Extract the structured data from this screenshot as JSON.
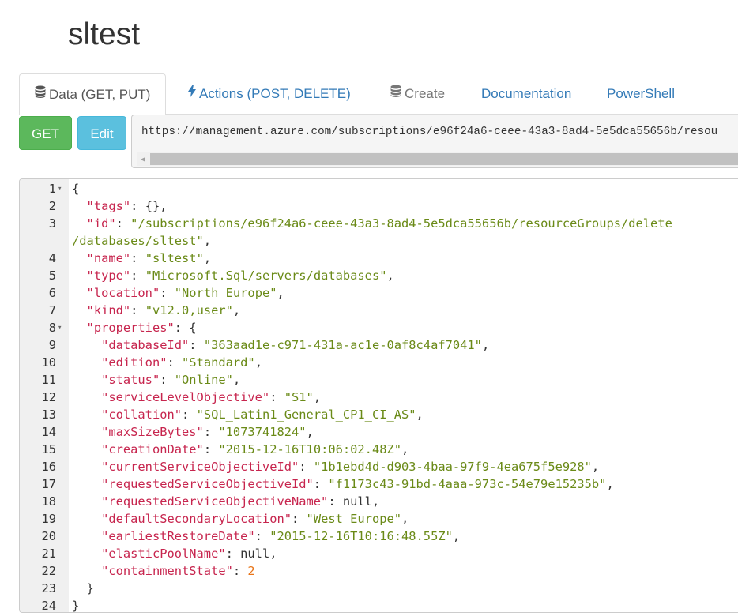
{
  "page": {
    "title": "sltest"
  },
  "tabs": [
    {
      "label": "Data (GET, PUT)",
      "icon": "database-icon",
      "active": true
    },
    {
      "label": "Actions (POST, DELETE)",
      "icon": "bolt-icon",
      "active": false
    },
    {
      "label": "Create",
      "icon": "database-icon",
      "active": false
    },
    {
      "label": "Documentation",
      "active": false
    },
    {
      "label": "PowerShell",
      "active": false
    }
  ],
  "buttons": {
    "get_label": "GET",
    "edit_label": "Edit"
  },
  "url": {
    "value": "https://management.azure.com/subscriptions/e96f24a6-ceee-43a3-8ad4-5e5dca55656b/resou"
  },
  "editor": {
    "lines": [
      {
        "n": "1",
        "fold": true,
        "t": [
          [
            "p",
            "{"
          ]
        ]
      },
      {
        "n": "2",
        "t": [
          [
            "p",
            "  "
          ],
          [
            "k",
            "\"tags\""
          ],
          [
            "p",
            ": {},"
          ]
        ]
      },
      {
        "n": "3",
        "t": [
          [
            "p",
            "  "
          ],
          [
            "k",
            "\"id\""
          ],
          [
            "p",
            ": "
          ],
          [
            "s",
            "\"/subscriptions/e96f24a6-ceee-43a3-8ad4-5e5dca55656b/resourceGroups/delete"
          ]
        ]
      },
      {
        "n": "",
        "t": [
          [
            "s",
            "/databases/sltest\""
          ],
          [
            "p",
            ","
          ]
        ]
      },
      {
        "n": "4",
        "t": [
          [
            "p",
            "  "
          ],
          [
            "k",
            "\"name\""
          ],
          [
            "p",
            ": "
          ],
          [
            "s",
            "\"sltest\""
          ],
          [
            "p",
            ","
          ]
        ]
      },
      {
        "n": "5",
        "t": [
          [
            "p",
            "  "
          ],
          [
            "k",
            "\"type\""
          ],
          [
            "p",
            ": "
          ],
          [
            "s",
            "\"Microsoft.Sql/servers/databases\""
          ],
          [
            "p",
            ","
          ]
        ]
      },
      {
        "n": "6",
        "t": [
          [
            "p",
            "  "
          ],
          [
            "k",
            "\"location\""
          ],
          [
            "p",
            ": "
          ],
          [
            "s",
            "\"North Europe\""
          ],
          [
            "p",
            ","
          ]
        ]
      },
      {
        "n": "7",
        "t": [
          [
            "p",
            "  "
          ],
          [
            "k",
            "\"kind\""
          ],
          [
            "p",
            ": "
          ],
          [
            "s",
            "\"v12.0,user\""
          ],
          [
            "p",
            ","
          ]
        ]
      },
      {
        "n": "8",
        "fold": true,
        "t": [
          [
            "p",
            "  "
          ],
          [
            "k",
            "\"properties\""
          ],
          [
            "p",
            ": {"
          ]
        ]
      },
      {
        "n": "9",
        "t": [
          [
            "p",
            "    "
          ],
          [
            "k",
            "\"databaseId\""
          ],
          [
            "p",
            ": "
          ],
          [
            "s",
            "\"363aad1e-c971-431a-ac1e-0af8c4af7041\""
          ],
          [
            "p",
            ","
          ]
        ]
      },
      {
        "n": "10",
        "t": [
          [
            "p",
            "    "
          ],
          [
            "k",
            "\"edition\""
          ],
          [
            "p",
            ": "
          ],
          [
            "s",
            "\"Standard\""
          ],
          [
            "p",
            ","
          ]
        ]
      },
      {
        "n": "11",
        "t": [
          [
            "p",
            "    "
          ],
          [
            "k",
            "\"status\""
          ],
          [
            "p",
            ": "
          ],
          [
            "s",
            "\"Online\""
          ],
          [
            "p",
            ","
          ]
        ]
      },
      {
        "n": "12",
        "t": [
          [
            "p",
            "    "
          ],
          [
            "k",
            "\"serviceLevelObjective\""
          ],
          [
            "p",
            ": "
          ],
          [
            "s",
            "\"S1\""
          ],
          [
            "p",
            ","
          ]
        ]
      },
      {
        "n": "13",
        "t": [
          [
            "p",
            "    "
          ],
          [
            "k",
            "\"collation\""
          ],
          [
            "p",
            ": "
          ],
          [
            "s",
            "\"SQL_Latin1_General_CP1_CI_AS\""
          ],
          [
            "p",
            ","
          ]
        ]
      },
      {
        "n": "14",
        "t": [
          [
            "p",
            "    "
          ],
          [
            "k",
            "\"maxSizeBytes\""
          ],
          [
            "p",
            ": "
          ],
          [
            "s",
            "\"1073741824\""
          ],
          [
            "p",
            ","
          ]
        ]
      },
      {
        "n": "15",
        "t": [
          [
            "p",
            "    "
          ],
          [
            "k",
            "\"creationDate\""
          ],
          [
            "p",
            ": "
          ],
          [
            "s",
            "\"2015-12-16T10:06:02.48Z\""
          ],
          [
            "p",
            ","
          ]
        ]
      },
      {
        "n": "16",
        "t": [
          [
            "p",
            "    "
          ],
          [
            "k",
            "\"currentServiceObjectiveId\""
          ],
          [
            "p",
            ": "
          ],
          [
            "s",
            "\"1b1ebd4d-d903-4baa-97f9-4ea675f5e928\""
          ],
          [
            "p",
            ","
          ]
        ]
      },
      {
        "n": "17",
        "t": [
          [
            "p",
            "    "
          ],
          [
            "k",
            "\"requestedServiceObjectiveId\""
          ],
          [
            "p",
            ": "
          ],
          [
            "s",
            "\"f1173c43-91bd-4aaa-973c-54e79e15235b\""
          ],
          [
            "p",
            ","
          ]
        ]
      },
      {
        "n": "18",
        "t": [
          [
            "p",
            "    "
          ],
          [
            "k",
            "\"requestedServiceObjectiveName\""
          ],
          [
            "p",
            ": null,"
          ]
        ]
      },
      {
        "n": "19",
        "t": [
          [
            "p",
            "    "
          ],
          [
            "k",
            "\"defaultSecondaryLocation\""
          ],
          [
            "p",
            ": "
          ],
          [
            "s",
            "\"West Europe\""
          ],
          [
            "p",
            ","
          ]
        ]
      },
      {
        "n": "20",
        "t": [
          [
            "p",
            "    "
          ],
          [
            "k",
            "\"earliestRestoreDate\""
          ],
          [
            "p",
            ": "
          ],
          [
            "s",
            "\"2015-12-16T10:16:48.55Z\""
          ],
          [
            "p",
            ","
          ]
        ]
      },
      {
        "n": "21",
        "t": [
          [
            "p",
            "    "
          ],
          [
            "k",
            "\"elasticPoolName\""
          ],
          [
            "p",
            ": null,"
          ]
        ]
      },
      {
        "n": "22",
        "t": [
          [
            "p",
            "    "
          ],
          [
            "k",
            "\"containmentState\""
          ],
          [
            "p",
            ": "
          ],
          [
            "n",
            "2"
          ]
        ]
      },
      {
        "n": "23",
        "t": [
          [
            "p",
            "  }"
          ]
        ]
      },
      {
        "n": "24",
        "t": [
          [
            "p",
            "}"
          ]
        ]
      }
    ]
  },
  "colors": {
    "get_button": "#5cb85c",
    "edit_button": "#5bc0de",
    "link": "#337ab7",
    "json_key": "#c7254e",
    "json_string": "#6a8a17",
    "json_number": "#e8751a"
  }
}
